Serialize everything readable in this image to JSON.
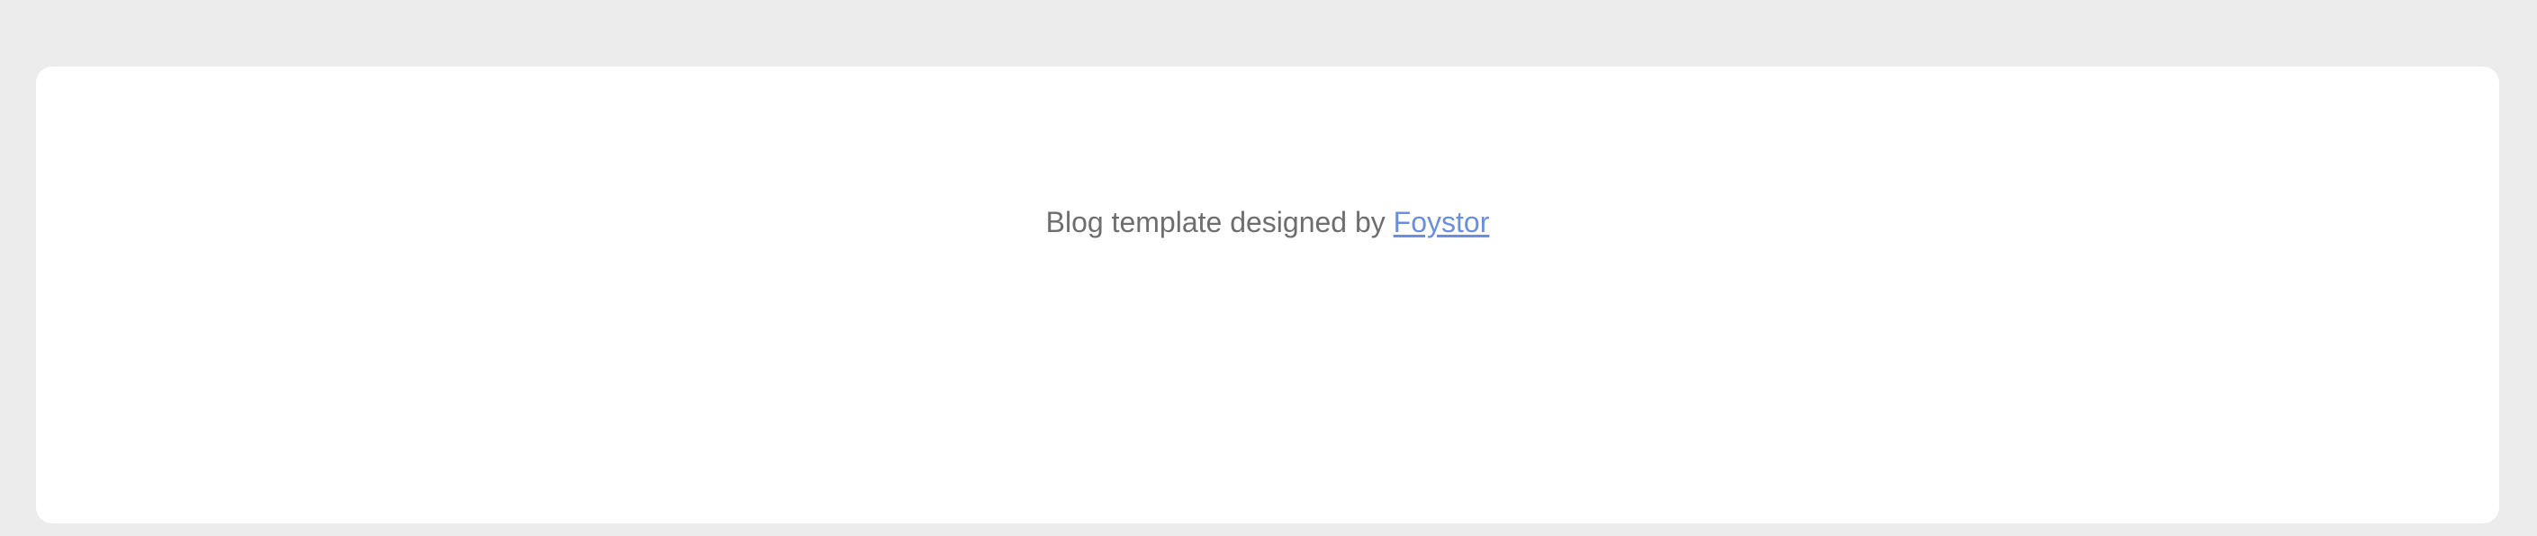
{
  "footer": {
    "credit_prefix": "Blog template designed by ",
    "credit_link_text": "Foystor"
  },
  "colors": {
    "page_background": "#ececec",
    "card_background": "#ffffff",
    "text": "#6e6e6e",
    "link": "#6a8fe0"
  }
}
